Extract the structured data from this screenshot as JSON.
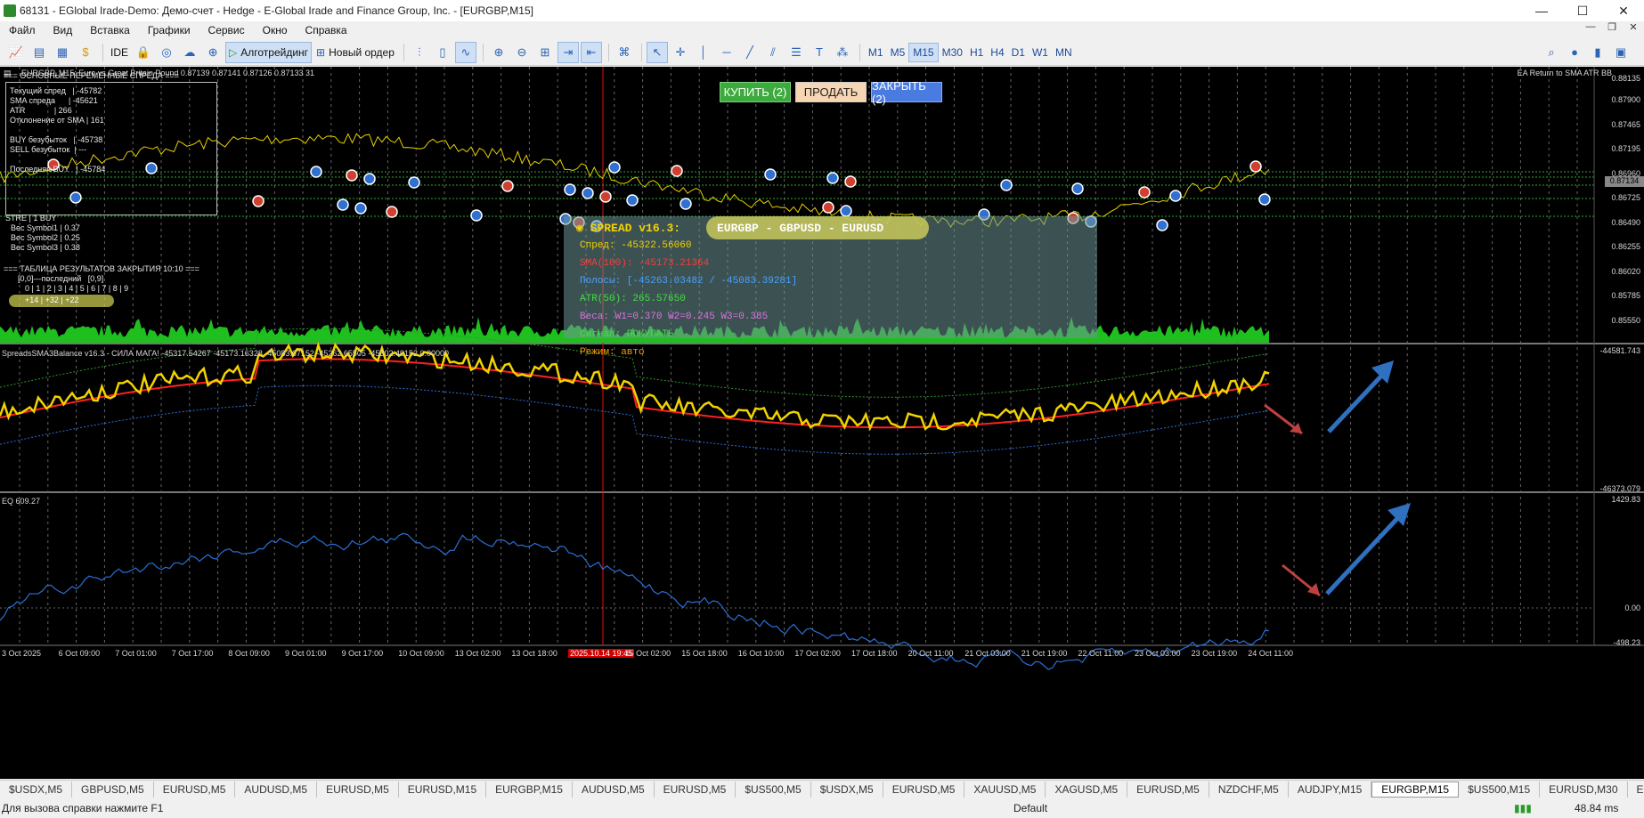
{
  "window": {
    "title": "68131 - EGlobal Irade-Demo: Демо-счет - Hedge - E-Global Irade and Finance Group, Inc. - [EURGBP,M15]",
    "controls": [
      "—",
      "☐",
      "✕"
    ]
  },
  "menu": {
    "items": [
      "Файл",
      "Вид",
      "Вставка",
      "Графики",
      "Сервис",
      "Окно",
      "Справка"
    ],
    "mdi": [
      "—",
      "❐",
      "✕"
    ]
  },
  "toolbar": {
    "ide_label": "IDE",
    "algotrading_label": "Алготрейдинг",
    "new_order_label": "Новый ордер",
    "timeframes": [
      "M1",
      "M5",
      "M15",
      "M30",
      "H1",
      "H4",
      "D1",
      "W1",
      "MN"
    ],
    "active_timeframe": "M15"
  },
  "chart": {
    "header": "EURGBP, M15:  Euro vs Great Britain Pound   0.87139 0.87141 0.87126 0.87133  31",
    "ea_name": "EA Return to SMA ATR BB",
    "buttons": {
      "buy": "КУПИТЬ (2)",
      "sell": "ПРОДАТЬ",
      "close": "ЗАКРЫТЬ (2)"
    },
    "spread_panel_title": "=== ОСНОВНЫЕ ПЕРЕМЕННЫЕ СПРЕДА ===",
    "spread_panel_rows": [
      "Текущий спред   | -45782",
      "SMA спреда      | -45621",
      "ATR             | 266",
      "Отклонение от SMA | 161",
      "",
      "BUY безубыток   | -45738",
      "SELL безубыток  | ---",
      "",
      "Последняя BUY   | -45784"
    ],
    "weights_rows": [
      "STRE | 1 BUY",
      "Вес Symbol1 | 0.37",
      "Вес Symbol2 | 0.25",
      "Вес Symbol3 | 0.38"
    ],
    "closing_table_title": "=== ТАБЛИЦА РЕЗУЛЬТАТОВ ЗАКРЫТИЯ 10:10 ===",
    "closing_table_sub": "[0,0]—последний   [0,9]",
    "closing_table_cols": "0 | 1 | 2 | 3 | 4 | 5 | 6 | 7 | 8 | 9",
    "closing_table_pill": "+14 | +32 | +22",
    "spread_box": {
      "title": "SPREAD v16.3:",
      "pairs": "EURGBP - GBPUSD - EURUSD",
      "lines": [
        {
          "text": "Спред: -45322.56060",
          "color": "#f2d200"
        },
        {
          "text": "SMA(100): -45173.21364",
          "color": "#ff3b3b"
        },
        {
          "text": "Полосы: [-45263.03482 / -45083.39281]",
          "color": "#4aa0ff"
        },
        {
          "text": "ATR(50): 265.57650",
          "color": "#40e040"
        },
        {
          "text": "Веса: W1=0.370 W2=0.245 W3=0.385",
          "color": "#e070e0"
        },
        {
          "text": "Сигнал: ПОКУПАТЬ",
          "color": "#40e040"
        },
        {
          "text": "Режим: авто",
          "color": "#f2a000"
        }
      ]
    },
    "price_axis": [
      "0.88135",
      "0.87900",
      "0.87465",
      "0.87195",
      "0.86960",
      "0.86725",
      "0.86490",
      "0.86255",
      "0.86020",
      "0.85785",
      "0.85550"
    ],
    "current_price": "0.87134",
    "indicator_header": "SpreadsSMA3Balance v16.3 - СИЛА МАГА! -45317.54267 -45173.16328 -45083.67152 -45262.65505 -45302.49152 0.00000",
    "indicator_axis": [
      "-44581.743",
      "-46373.079"
    ],
    "eq_header": "EQ 609.27",
    "eq_axis": [
      "1429.83",
      "0.00",
      "-498.23"
    ],
    "time_axis": [
      "3 Oct 2025",
      "6 Oct 09:00",
      "7 Oct 01:00",
      "7 Oct 17:00",
      "8 Oct 09:00",
      "9 Oct 01:00",
      "9 Oct 17:00",
      "10 Oct 09:00",
      "13 Oct 02:00",
      "13 Oct 18:00",
      "2025.10.14 19:45",
      "15 Oct 02:00",
      "15 Oct 18:00",
      "16 Oct 10:00",
      "17 Oct 02:00",
      "17 Oct 18:00",
      "20 Oct 11:00",
      "21 Oct 03:00",
      "21 Oct 19:00",
      "22 Oct 11:00",
      "23 Oct 03:00",
      "23 Oct 19:00",
      "24 Oct 11:00"
    ],
    "highlight_time": "2025.10.14 19:45"
  },
  "tabs": {
    "items": [
      "$USDX,M5",
      "GBPUSD,M5",
      "EURUSD,M5",
      "AUDUSD,M5",
      "EURUSD,M5",
      "EURUSD,M15",
      "EURGBP,M15",
      "AUDUSD,M5",
      "EURUSD,M5",
      "$US500,M5",
      "$USDX,M5",
      "EURUSD,M5",
      "XAUUSD,M5",
      "XAGUSD,M5",
      "EURUSD,M5",
      "NZDCHF,M5",
      "AUDJPY,M15",
      "EURGBP,M15",
      "$US500,M15",
      "EURUSD,M30",
      "EURJ"
    ],
    "active_index": 17
  },
  "status": {
    "help": "Для вызова справки нажмите F1",
    "profile": "Default",
    "ping": "48.84 ms"
  },
  "colors": {
    "buy_green": "#3daa3d",
    "sell_peach": "#f7d6b4",
    "close_blue": "#4a7be0",
    "spread_yellow": "#f2d200",
    "sma_red": "#ff2020",
    "band_blue": "#2a6fd6",
    "volume_green": "#1fbf1f"
  }
}
